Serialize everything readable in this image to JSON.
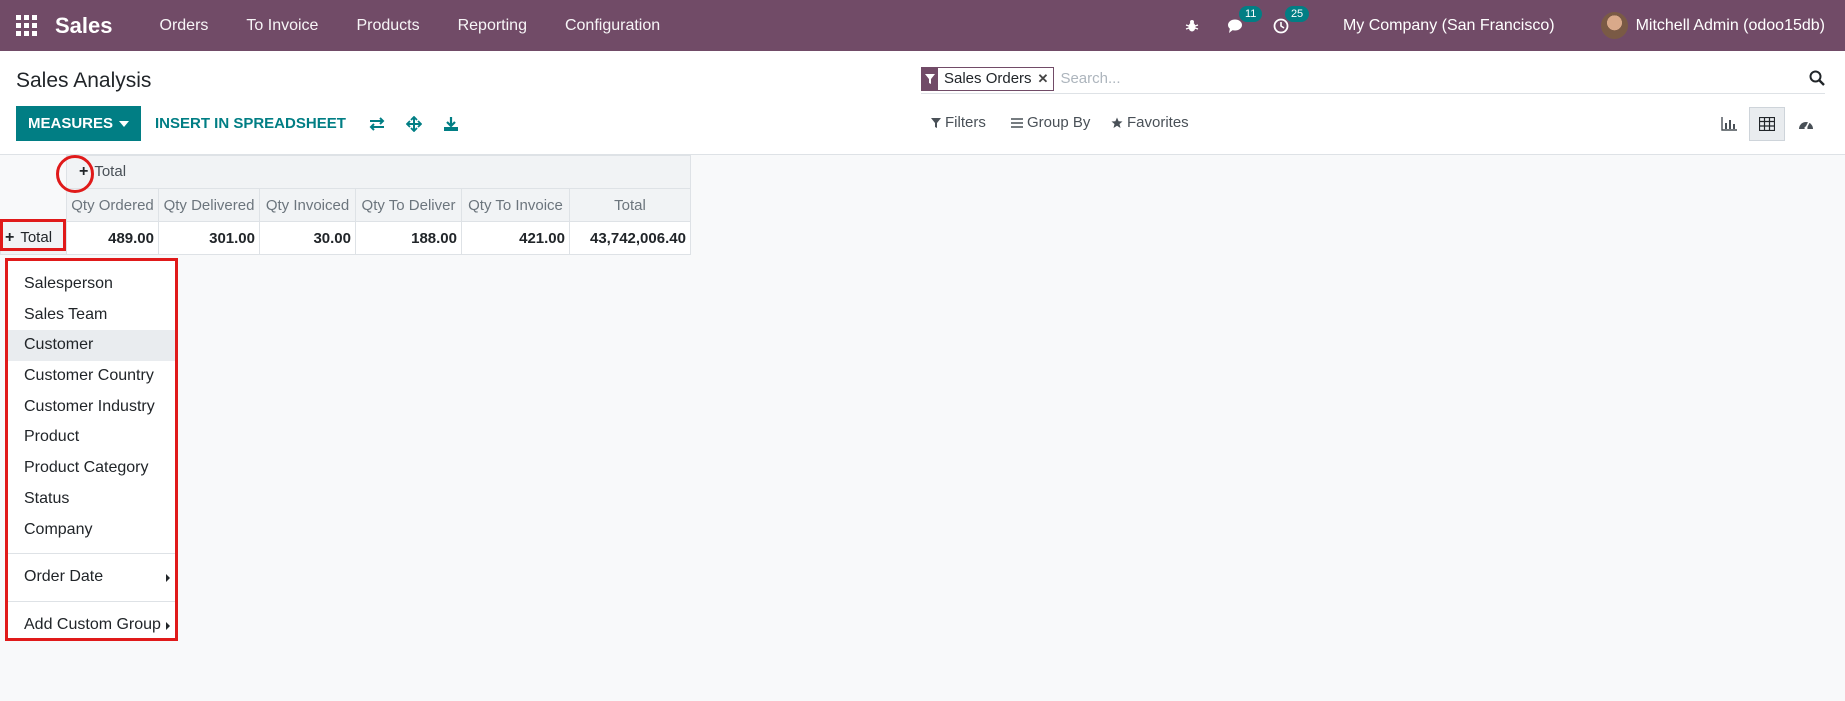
{
  "navbar": {
    "app_name": "Sales",
    "menu": [
      "Orders",
      "To Invoice",
      "Products",
      "Reporting",
      "Configuration"
    ],
    "messages_count": "11",
    "activities_count": "25",
    "company": "My Company (San Francisco)",
    "user": "Mitchell Admin (odoo15db)"
  },
  "control": {
    "title": "Sales Analysis",
    "measures_label": "MEASURES",
    "spreadsheet_label": "INSERT IN SPREADSHEET",
    "facet_label": "Sales Orders",
    "search_placeholder": "Search...",
    "filters_label": "Filters",
    "groupby_label": "Group By",
    "favorites_label": "Favorites"
  },
  "pivot": {
    "col_header": "Total",
    "measures": [
      "Qty Ordered",
      "Qty Delivered",
      "Qty Invoiced",
      "Qty To Deliver",
      "Qty To Invoice",
      "Total"
    ],
    "row_header": "Total",
    "values": [
      "489.00",
      "301.00",
      "30.00",
      "188.00",
      "421.00",
      "43,742,006.40"
    ]
  },
  "dropdown": {
    "items": [
      "Salesperson",
      "Sales Team",
      "Customer",
      "Customer Country",
      "Customer Industry",
      "Product",
      "Product Category",
      "Status",
      "Company"
    ],
    "order_date": "Order Date",
    "custom_group": "Add Custom Group"
  },
  "colors": {
    "navbar": "#714b67",
    "primary": "#017e84",
    "annotation": "#e01a1a"
  }
}
